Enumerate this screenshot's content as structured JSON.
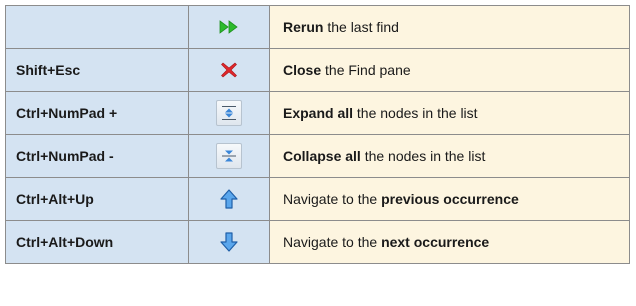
{
  "rows": [
    {
      "key": "",
      "icon": "rerun-icon",
      "bold": "Rerun",
      "text": " the last find",
      "layout": "bold-first"
    },
    {
      "key": "Shift+Esc",
      "icon": "close-icon",
      "bold": "Close",
      "text": " the Find pane",
      "layout": "bold-first"
    },
    {
      "key": "Ctrl+NumPad +",
      "icon": "expand-all-icon",
      "bold": "Expand all",
      "text": " the nodes in the list",
      "layout": "bold-first"
    },
    {
      "key": "Ctrl+NumPad -",
      "icon": "collapse-all-icon",
      "bold": "Collapse all",
      "text": " the nodes in the list",
      "layout": "bold-first"
    },
    {
      "key": "Ctrl+Alt+Up",
      "icon": "arrow-up-icon",
      "pre": "Navigate to the ",
      "bold": "previous occurrence",
      "layout": "bold-last"
    },
    {
      "key": "Ctrl+Alt+Down",
      "icon": "arrow-down-icon",
      "pre": "Navigate to the ",
      "bold": "next occurrence",
      "layout": "bold-last"
    }
  ],
  "colors": {
    "key_bg": "#d4e3f2",
    "desc_bg": "#fdf5e0",
    "border": "#8c8c8c",
    "rerun_green": "#2dbb2d",
    "close_red": "#e0272b",
    "arrow_blue": "#3a86d8"
  }
}
